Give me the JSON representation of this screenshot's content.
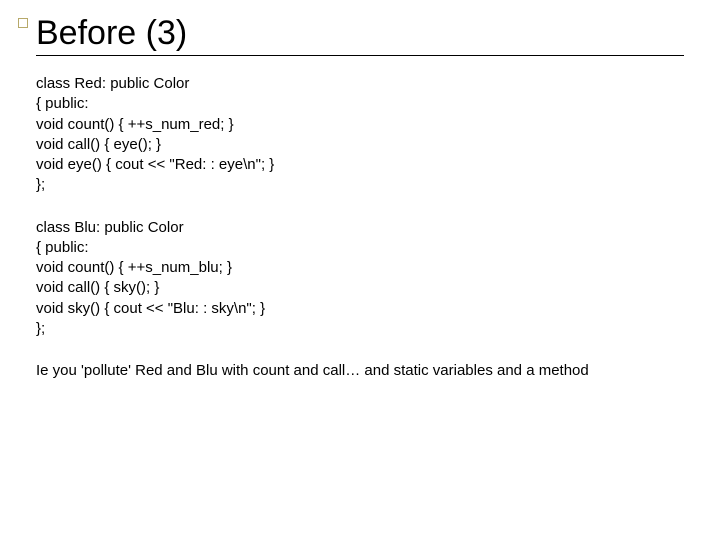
{
  "title": "Before (3)",
  "code_red": {
    "l1": "class Red: public Color",
    "l2": "{ public:",
    "l3": "void count() { ++s_num_red; }",
    "l4": "void call() { eye(); }",
    "l5": "void eye() { cout << \"Red: : eye\\n\"; }",
    "l6": "};"
  },
  "code_blu": {
    "l1": "class Blu: public Color",
    "l2": "{ public:",
    "l3": "void count() { ++s_num_blu; }",
    "l4": "void call() { sky(); }",
    "l5": "void sky() { cout << \"Blu: : sky\\n\"; }",
    "l6": "};"
  },
  "note": "Ie you 'pollute' Red and Blu with count and call… and static variables and a method"
}
